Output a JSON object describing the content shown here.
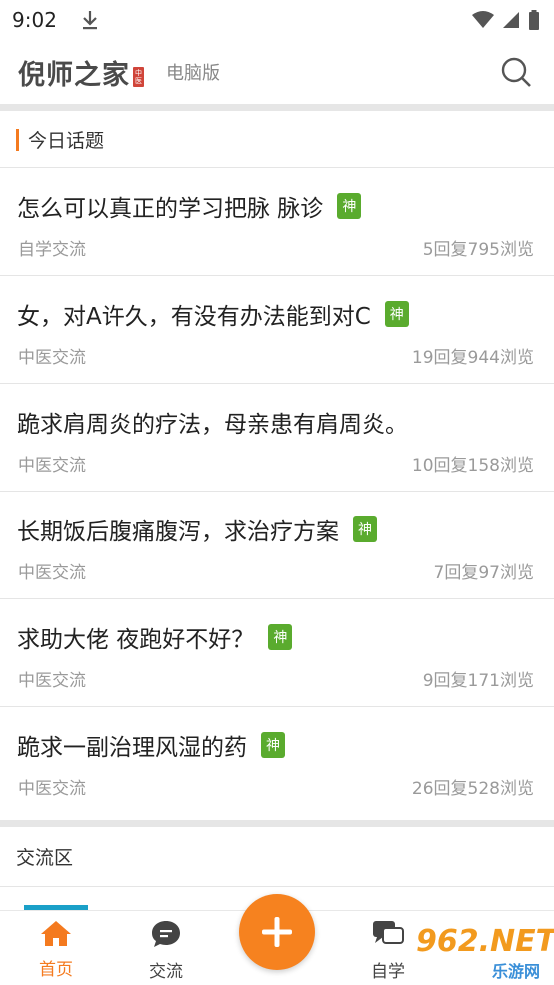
{
  "status_bar": {
    "time": "9:02"
  },
  "header": {
    "logo": "倪师之家",
    "seal": "中医",
    "sub_label": "电脑版"
  },
  "today": {
    "heading": "今日话题",
    "topics": [
      {
        "title": "怎么可以真正的学习把脉 脉诊",
        "badge": "神",
        "category": "自学交流",
        "stats": "5回复795浏览"
      },
      {
        "title": "女，对A许久，有没有办法能到对C",
        "badge": "神",
        "category": "中医交流",
        "stats": "19回复944浏览"
      },
      {
        "title": "跪求肩周炎的疗法，母亲患有肩周炎。",
        "badge": "",
        "category": "中医交流",
        "stats": "10回复158浏览"
      },
      {
        "title": "长期饭后腹痛腹泻，求治疗方案",
        "badge": "神",
        "category": "中医交流",
        "stats": "7回复97浏览"
      },
      {
        "title": "求助大佬 夜跑好不好？",
        "badge": "神",
        "category": "中医交流",
        "stats": "9回复171浏览"
      },
      {
        "title": "跪求一副治理风湿的药",
        "badge": "神",
        "category": "中医交流",
        "stats": "26回复528浏览"
      }
    ]
  },
  "forum": {
    "heading": "交流区"
  },
  "tabbar": {
    "home": "首页",
    "exchange": "交流",
    "study": "自学"
  },
  "watermark": {
    "main": "962.NET",
    "sub": "乐游网"
  },
  "colors": {
    "accent": "#f47a1f",
    "badge": "#5aab2e"
  }
}
